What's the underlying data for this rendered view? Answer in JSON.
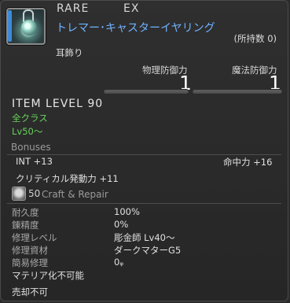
{
  "header": {
    "rarity": "RARE",
    "ex": "EX",
    "item_name": "トレマー･キャスターイヤリング",
    "owned": "(所持数 0)",
    "category": "耳飾り"
  },
  "defense": {
    "physical_label": "物理防御力",
    "physical_value": "1",
    "magic_label": "魔法防御力",
    "magic_value": "1"
  },
  "item_level": "ITEM LEVEL 90",
  "requirements": {
    "class": "全クラス",
    "level": "Lv50～"
  },
  "bonuses": {
    "title": "Bonuses",
    "int": "INT +13",
    "accuracy": "命中力 +16",
    "crit": "クリティカル発動力 +11"
  },
  "craft": {
    "number": "50",
    "title": "Craft & Repair",
    "rows": [
      {
        "label": "耐久度",
        "value": "100%"
      },
      {
        "label": "錬精度",
        "value": "0%"
      },
      {
        "label": "修理レベル",
        "value": "彫金師 Lv40～"
      },
      {
        "label": "修理資材",
        "value": "ダークマターG5"
      },
      {
        "label": "簡易修理",
        "value": "0ᵩ"
      }
    ],
    "materia": "マテリア化不可能"
  },
  "footer": {
    "untradable": "売却不可"
  },
  "colors": {
    "item_name": "#6fb1ff",
    "requirement": "#66d35a"
  }
}
